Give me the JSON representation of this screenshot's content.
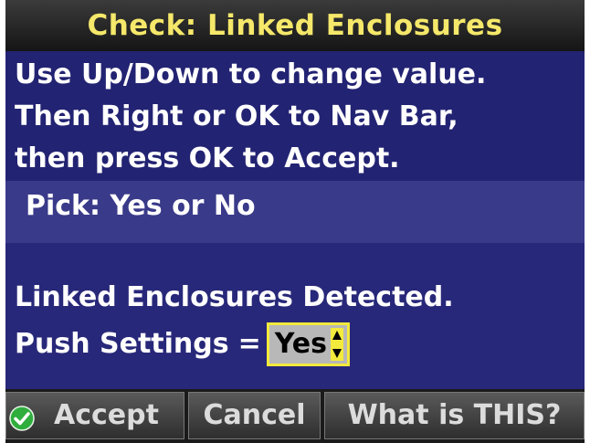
{
  "title": "Check: Linked Enclosures",
  "instructions": {
    "line1": "Use Up/Down to change value.",
    "line2": "Then Right or OK to Nav Bar,",
    "line3": "then press OK to Accept."
  },
  "pick": {
    "label": "Pick: Yes or No"
  },
  "content": {
    "detected": "Linked Enclosures Detected.",
    "push_label": "Push Settings",
    "push_eq": "=",
    "push_value": "Yes"
  },
  "nav": {
    "accept": "Accept",
    "cancel": "Cancel",
    "what": "What is THIS?"
  },
  "icons": {
    "accept": "check-circle-icon",
    "spinner": "up-down-arrows-icon"
  },
  "colors": {
    "title_text": "#f5e86a",
    "screen_bg": "#28287a",
    "pick_bg": "#3a3a8a",
    "highlight": "#f2ea3c",
    "check_green": "#2fae3e"
  }
}
